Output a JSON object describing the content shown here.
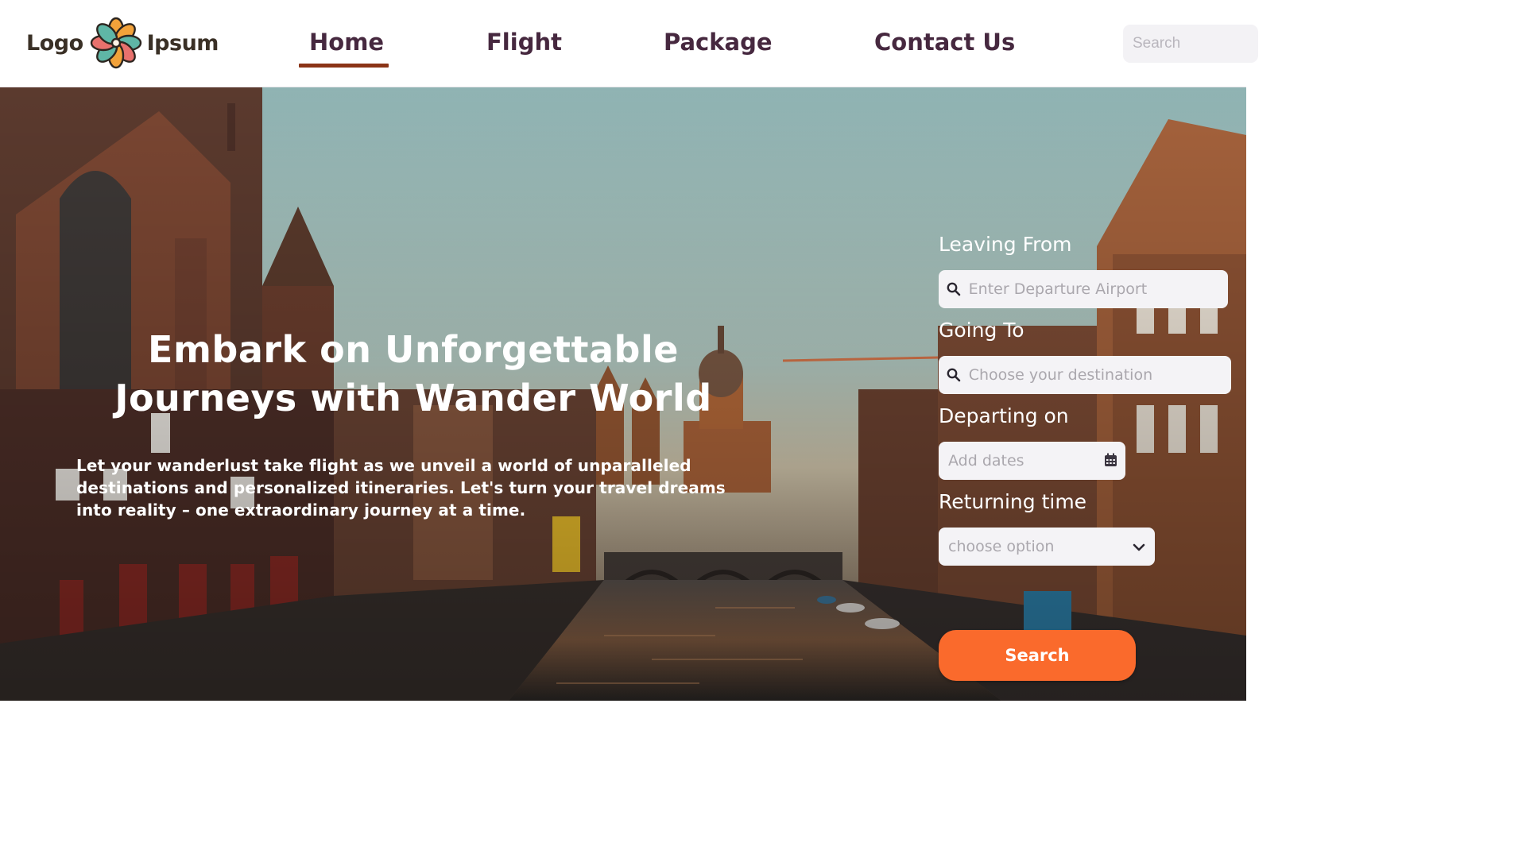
{
  "brand": {
    "word_left": "Logo",
    "word_right": "Ipsum"
  },
  "nav": {
    "items": [
      {
        "label": "Home",
        "active": true
      },
      {
        "label": "Flight",
        "active": false
      },
      {
        "label": "Package",
        "active": false
      },
      {
        "label": "Contact Us",
        "active": false
      }
    ]
  },
  "header_search": {
    "placeholder": "Search"
  },
  "hero": {
    "title": "Embark on Unforgettable Journeys with Wander World",
    "subtitle": "Let your wanderlust take flight as we unveil a world of unparalleled destinations and personalized itineraries. Let's turn your travel dreams into reality – one extraordinary journey at a time."
  },
  "booking": {
    "leaving_label": "Leaving From",
    "leaving_placeholder": "Enter Departure Airport",
    "going_label": "Going To",
    "going_placeholder": "Choose your destination",
    "departing_label": "Departing on",
    "departing_placeholder": "Add dates",
    "returning_label": "Returning time",
    "returning_selected": "choose option",
    "submit_label": "Search"
  },
  "colors": {
    "nav_text": "#46283f",
    "active_underline": "#8b3417",
    "primary_button": "#fa6a2c",
    "field_bg": "#f4f3f6"
  },
  "icons": {
    "logo": "flower-logo-icon",
    "field_search": "search-icon",
    "date": "calendar-icon",
    "select": "chevron-down-icon"
  }
}
